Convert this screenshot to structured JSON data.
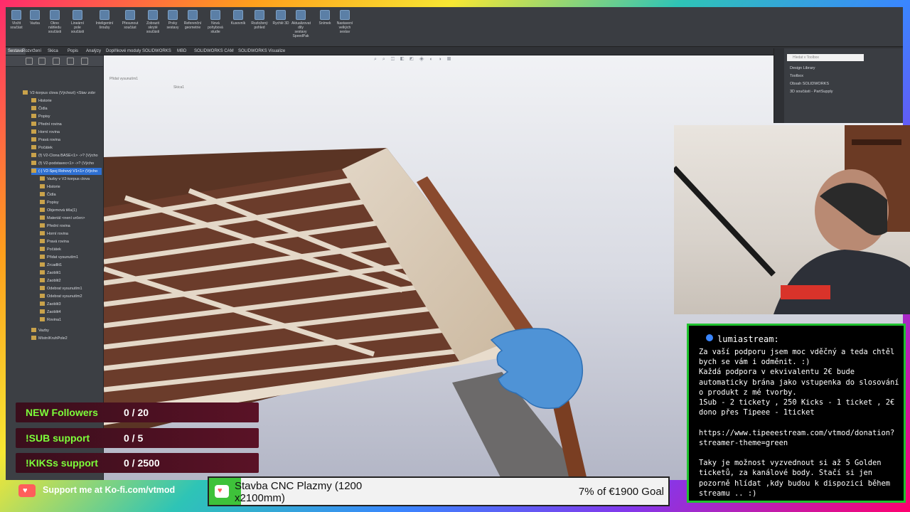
{
  "cad": {
    "ribbon_buttons": [
      "Vložit součást",
      "Vazba",
      "Okno náhledu součásti",
      "Lineární pole součásti",
      "Inteligentní šrouby",
      "Přesunout součást",
      "Zobrazit skryté součásti",
      "Prvky sestavy",
      "Referenční geometrie",
      "Nová pohybová studie",
      "Kusovník",
      "Rozložený pohled",
      "Rychlé 3D",
      "Aktualizovat díly sestavy SpeedPak",
      "Snímek",
      "Nastavení velkých sestav"
    ],
    "command_tabs": [
      "Sestava",
      "Rozvržení",
      "Skica",
      "Popis",
      "Analýzy",
      "Doplňkové moduly SOLIDWORKS",
      "MBD",
      "SOLIDWORKS CAM",
      "SOLIDWORKS Visualize"
    ],
    "tree_items": [
      "V2-korpus clova (Výchozí) <Stav zobr",
      "Historie",
      "Čidla",
      "Popisy",
      "Přední rovina",
      "Horní rovina",
      "Pravá rovina",
      "Počátek",
      "(f) V2-Clona BASE<1> ->? (Výcho",
      "(f) V2-podstavec<1> ->? (Výcho",
      "(-) V2-Spoj Rohový V1<1> (Výcho",
      "Vazby v V2-korpus clova",
      "Historie",
      "Čidla",
      "Popisy",
      "Objemová těla(1)",
      "Materiál <není určen>",
      "Přední rovina",
      "Horní rovina",
      "Pravá rovina",
      "Počátek",
      "Přidat vysunutím1",
      "Zrcadlit1",
      "Zaoblit1",
      "Zaoblit2",
      "Odebrat vysunutím1",
      "Odebrat vysunutím2",
      "Zaoblit3",
      "Zaoblit4",
      "Rovina1",
      "Vazby",
      "MístníKruhPole2"
    ],
    "feature_label": "Přidat vysunutím1",
    "feature_sub": "Skica1",
    "task_pane": {
      "search_placeholder": "Hledat v Toolbox",
      "items": [
        "Design Library",
        "Toolbox",
        "Obsah SOLIDWORKS",
        "3D součásti - PartSupply"
      ]
    }
  },
  "chat": {
    "username": "lumiastream:",
    "message": "Za vaší podporu jsem moc vděčný a teda chtěl bych se vám i odměnit. :)\nKaždá podpora v ekvivalentu 2€ bude automaticky brána jako vstupenka do slosování o produkt z mé tvorby.\n1Sub - 2 tickety , 250 Kicks - 1 ticket , 2€ dono přes Tipeee - 1ticket\n\nhttps://www.tipeeestream.com/vtmod/donation?streamer-theme=green\n\nTaky je možnost vyzvednout si až 5 Golden ticketů, za kanálové body. Stačí si jen pozorně hlídat ,kdy budou k dispozici během streamu .. :)"
  },
  "goals": [
    {
      "label": "NEW Followers",
      "value": "0 / 20"
    },
    {
      "label": "!SUB support",
      "value": "0 / 5"
    },
    {
      "label": "!KIKSs support",
      "value": "0 / 2500"
    }
  ],
  "kofi": {
    "text": "Support me at Ko-fi.com/vtmod"
  },
  "goalbar": {
    "title": "Stavba CNC Plazmy (1200 x2100mm)",
    "progress_text": "7% of €1900 Goal",
    "progress": 0.07
  }
}
